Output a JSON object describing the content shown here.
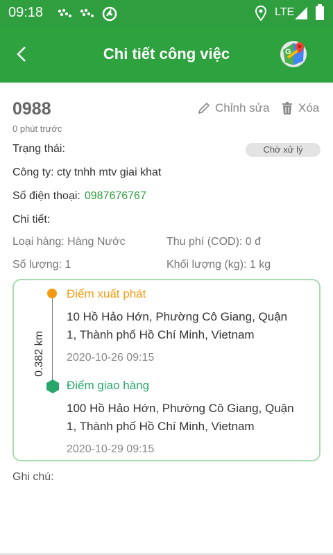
{
  "status_bar": {
    "time": "09:18",
    "network": "LTE"
  },
  "app_bar": {
    "title": "Chi tiết công việc"
  },
  "order": {
    "id": "0988",
    "time_ago": "0 phút trước",
    "edit_label": "Chỉnh sửa",
    "delete_label": "Xóa"
  },
  "fields": {
    "status_label": "Trạng thái:",
    "status_value": "Chờ xử lý",
    "company": "Công ty: cty tnhh mtv giai khat",
    "phone_label": "Số điện thoại:",
    "phone_value": "0987676767",
    "detail_label": "Chi tiết:",
    "goods_type": "Loại hàng: Hàng Nước",
    "cod": "Thu phí (COD): 0 đ",
    "quantity": "Số lượng: 1",
    "weight": "Khối lượng (kg): 1 kg"
  },
  "route": {
    "distance": "0.382 km",
    "start_label": "Điểm xuất phát",
    "start_address_line1": "10 Hồ Hảo Hớn, Phường Cô Giang, Quận",
    "start_address_line2": "1, Thành phố Hồ Chí Minh, Vietnam",
    "start_time": "2020-10-26 09:15",
    "end_label": "Điểm giao hàng",
    "end_address_line1": "100 Hồ Hảo Hớn, Phường Cô Giang, Quận",
    "end_address_line2": "1, Thành phố Hồ Chí Minh, Vietnam",
    "end_time": "2020-10-29 09:15"
  },
  "note_label": "Ghi chú:",
  "colors": {
    "primary": "#2ea23f",
    "start": "#f39c12",
    "end": "#26a66b"
  }
}
